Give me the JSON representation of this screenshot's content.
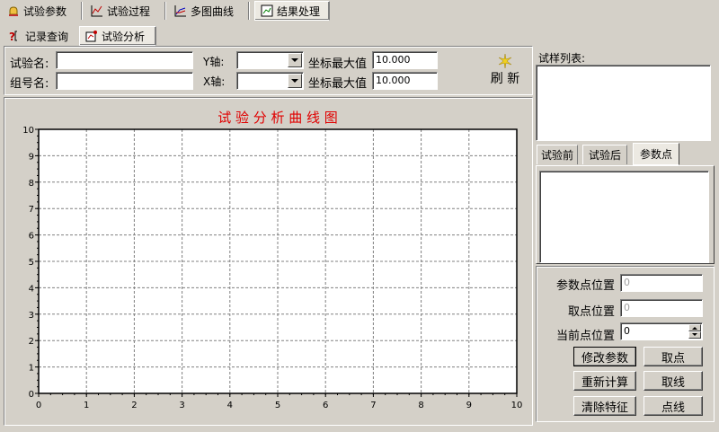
{
  "main_tabs": [
    {
      "label": "试验参数",
      "icon": "bell-icon"
    },
    {
      "label": "试验过程",
      "icon": "chart-icon"
    },
    {
      "label": "多图曲线",
      "icon": "multi-chart-icon"
    },
    {
      "label": "结果处理",
      "icon": "result-icon"
    }
  ],
  "sub_tabs": [
    {
      "label": "记录查询"
    },
    {
      "label": "试验分析"
    }
  ],
  "form": {
    "test_name_label": "试验名:",
    "group_name_label": "组号名:",
    "y_axis_label": "Y轴:",
    "x_axis_label": "X轴:",
    "y_max_label": "坐标最大值",
    "x_max_label": "坐标最大值",
    "y_max_value": "10.000",
    "x_max_value": "10.000",
    "refresh_label": "刷 新"
  },
  "sample_list": {
    "label": "试样列表:"
  },
  "right_tabs": [
    {
      "label": "试验前"
    },
    {
      "label": "试验后"
    },
    {
      "label": "参数点"
    }
  ],
  "params": {
    "param_point_label": "参数点位置",
    "param_point_value": "0",
    "take_point_label": "取点位置",
    "take_point_value": "0",
    "current_point_label": "当前点位置",
    "current_point_value": "0"
  },
  "buttons": {
    "modify_params": "修改参数",
    "take_point": "取点",
    "recalculate": "重新计算",
    "take_line": "取线",
    "clear_features": "清除特征",
    "point_line": "点线"
  },
  "chart_data": {
    "type": "line",
    "title": "试 验 分 析 曲 线 图",
    "xlim": [
      0,
      10
    ],
    "ylim": [
      0,
      10
    ],
    "x_ticks": [
      "0",
      "1",
      "2",
      "3",
      "4",
      "5",
      "6",
      "7",
      "8",
      "9",
      "10"
    ],
    "y_ticks": [
      "0",
      "1",
      "2",
      "3",
      "4",
      "5",
      "6",
      "7",
      "8",
      "9",
      "10"
    ],
    "grid": true,
    "series": [],
    "colors": {
      "title": "#e00000",
      "grid": "#808080"
    }
  }
}
